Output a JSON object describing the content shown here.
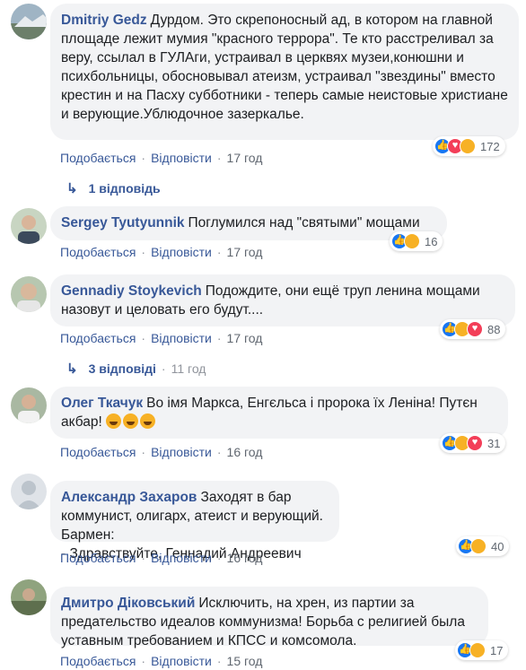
{
  "labels": {
    "like": "Подобається",
    "reply": "Відповісти",
    "dot": "·"
  },
  "colors": {
    "author": "#385898",
    "bubble": "#f2f3f5",
    "like": "#1877f2",
    "love": "#f33e58",
    "haha": "#f7b125"
  },
  "comments": [
    {
      "author": "Dmitriy Gedz",
      "text": "Дурдом. Это скрепоносный ад, в котором на главной площаде лежит мумия \"красного террора\". Те кто расстреливал за веру, ссылал в ГУЛАги, устраивал в церквях музеи,конюшни и психбольницы, обосновывал атеизм, устраивал \"звездины\" вместо крестин и на Пасху субботники - теперь самые неистовые христиане и верующие.Ублюдочное зазеркалье.",
      "time": "17 год",
      "reactions": [
        "like",
        "love",
        "haha"
      ],
      "count": "172",
      "replies": "1 відповідь",
      "replies_time": ""
    },
    {
      "author": "Sergey Tyutyunnik",
      "text": "Поглумился над \"святыми\" мощами",
      "time": "17 год",
      "reactions": [
        "like",
        "haha"
      ],
      "count": "16"
    },
    {
      "author": "Gennadiy Stoykevich",
      "text": "Подождите, они ещё труп ленина мощами назовут и целовать его будут....",
      "time": "17 год",
      "reactions": [
        "like",
        "haha",
        "love"
      ],
      "count": "88",
      "replies": "3 відповіді",
      "replies_time": "11 год"
    },
    {
      "author": "Олег Ткачук",
      "text": "Во імя Маркса, Енгєльса і пророка їх Леніна! Путєн акбар!",
      "time": "16 год",
      "reactions": [
        "like",
        "haha",
        "love"
      ],
      "count": "31"
    },
    {
      "author": "Александр Захаров",
      "text": "Заходят в бар коммунист, олигарх, атеист и верующий. Бармен:\n- Здравствуйте, Геннадий Андреевич",
      "time": "16 год",
      "reactions": [
        "like",
        "haha"
      ],
      "count": "40"
    },
    {
      "author": "Дмитро Діковський",
      "text": "Исключить, на хрен, из партии за предательство идеалов коммунизма! Борьба с религией была уставным требованием и КПСС и комсомола.",
      "time": "15 год",
      "reactions": [
        "like",
        "haha"
      ],
      "count": "17"
    }
  ]
}
